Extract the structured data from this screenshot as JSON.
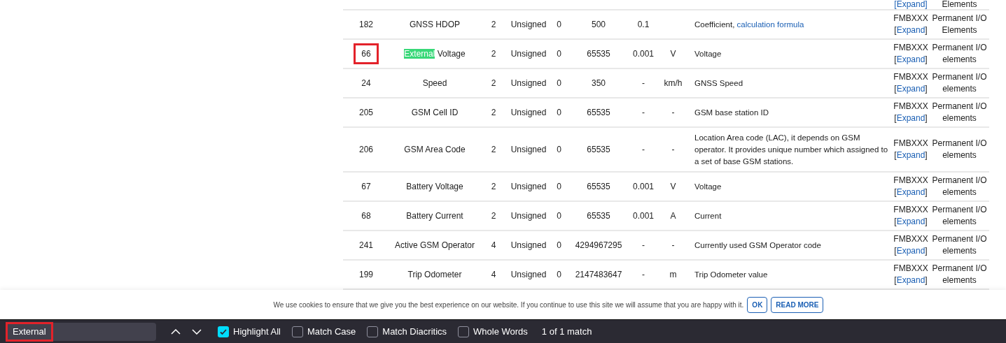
{
  "table": {
    "partial_row": {
      "expand": "[Expand]",
      "group": "Elements"
    },
    "rows": [
      {
        "id": "182",
        "id_outlined": false,
        "name": [
          {
            "text": "GNSS HDOP",
            "highlighted": false
          }
        ],
        "size": "2",
        "type": "Unsigned",
        "min": "0",
        "max": "500",
        "multiplier": "0.1",
        "units": "",
        "description": [
          {
            "kind": "text",
            "text": "Coefficient, "
          },
          {
            "kind": "link",
            "text": "calculation formula"
          }
        ],
        "model": "FMBXXX",
        "expand": "[Expand]",
        "group": "Permanent I/O Elements"
      },
      {
        "id": "66",
        "id_outlined": true,
        "name": [
          {
            "text": "External",
            "highlighted": true
          },
          {
            "text": " Voltage",
            "highlighted": false
          }
        ],
        "size": "2",
        "type": "Unsigned",
        "min": "0",
        "max": "65535",
        "multiplier": "0.001",
        "units": "V",
        "description": [
          {
            "kind": "text",
            "text": "Voltage"
          }
        ],
        "model": "FMBXXX",
        "expand": "[Expand]",
        "group": "Permanent I/O elements"
      },
      {
        "id": "24",
        "id_outlined": false,
        "name": [
          {
            "text": "Speed",
            "highlighted": false
          }
        ],
        "size": "2",
        "type": "Unsigned",
        "min": "0",
        "max": "350",
        "multiplier": "-",
        "units": "km/h",
        "description": [
          {
            "kind": "text",
            "text": "GNSS Speed"
          }
        ],
        "model": "FMBXXX",
        "expand": "[Expand]",
        "group": "Permanent I/O elements"
      },
      {
        "id": "205",
        "id_outlined": false,
        "name": [
          {
            "text": "GSM Cell ID",
            "highlighted": false
          }
        ],
        "size": "2",
        "type": "Unsigned",
        "min": "0",
        "max": "65535",
        "multiplier": "-",
        "units": "-",
        "description": [
          {
            "kind": "text",
            "text": "GSM base station ID"
          }
        ],
        "model": "FMBXXX",
        "expand": "[Expand]",
        "group": "Permanent I/O elements"
      },
      {
        "id": "206",
        "id_outlined": false,
        "name": [
          {
            "text": "GSM Area Code",
            "highlighted": false
          }
        ],
        "size": "2",
        "type": "Unsigned",
        "min": "0",
        "max": "65535",
        "multiplier": "-",
        "units": "-",
        "description": [
          {
            "kind": "text",
            "text": "Location Area code (LAC), it depends on GSM operator. It provides unique number which assigned to a set of base GSM stations."
          }
        ],
        "model": "FMBXXX",
        "expand": "[Expand]",
        "group": "Permanent I/O elements"
      },
      {
        "id": "67",
        "id_outlined": false,
        "name": [
          {
            "text": "Battery Voltage",
            "highlighted": false
          }
        ],
        "size": "2",
        "type": "Unsigned",
        "min": "0",
        "max": "65535",
        "multiplier": "0.001",
        "units": "V",
        "description": [
          {
            "kind": "text",
            "text": "Voltage"
          }
        ],
        "model": "FMBXXX",
        "expand": "[Expand]",
        "group": "Permanent I/O elements"
      },
      {
        "id": "68",
        "id_outlined": false,
        "name": [
          {
            "text": "Battery Current",
            "highlighted": false
          }
        ],
        "size": "2",
        "type": "Unsigned",
        "min": "0",
        "max": "65535",
        "multiplier": "0.001",
        "units": "A",
        "description": [
          {
            "kind": "text",
            "text": "Current"
          }
        ],
        "model": "FMBXXX",
        "expand": "[Expand]",
        "group": "Permanent I/O elements"
      },
      {
        "id": "241",
        "id_outlined": false,
        "name": [
          {
            "text": "Active GSM Operator",
            "highlighted": false
          }
        ],
        "size": "4",
        "type": "Unsigned",
        "min": "0",
        "max": "4294967295",
        "multiplier": "-",
        "units": "-",
        "description": [
          {
            "kind": "text",
            "text": "Currently used GSM Operator code"
          }
        ],
        "model": "FMBXXX",
        "expand": "[Expand]",
        "group": "Permanent I/O elements"
      },
      {
        "id": "199",
        "id_outlined": false,
        "name": [
          {
            "text": "Trip Odometer",
            "highlighted": false
          }
        ],
        "size": "4",
        "type": "Unsigned",
        "min": "0",
        "max": "2147483647",
        "multiplier": "-",
        "units": "m",
        "description": [
          {
            "kind": "text",
            "text": "Trip Odometer value"
          }
        ],
        "model": "FMBXXX",
        "expand": "[Expand]",
        "group": "Permanent I/O elements"
      }
    ]
  },
  "cookie_notice": {
    "text": "We use cookies to ensure that we give you the best experience on our website. If you continue to use this site we will assume that you are happy with it.",
    "buttons": [
      "OK",
      "READ MORE"
    ]
  },
  "find_bar": {
    "value": "External",
    "outlined": true,
    "options": [
      {
        "label": "Highlight All",
        "checked": true
      },
      {
        "label": "Match Case",
        "checked": false
      },
      {
        "label": "Match Diacritics",
        "checked": false
      },
      {
        "label": "Whole Words",
        "checked": false
      }
    ],
    "result": "1 of 1 match"
  }
}
